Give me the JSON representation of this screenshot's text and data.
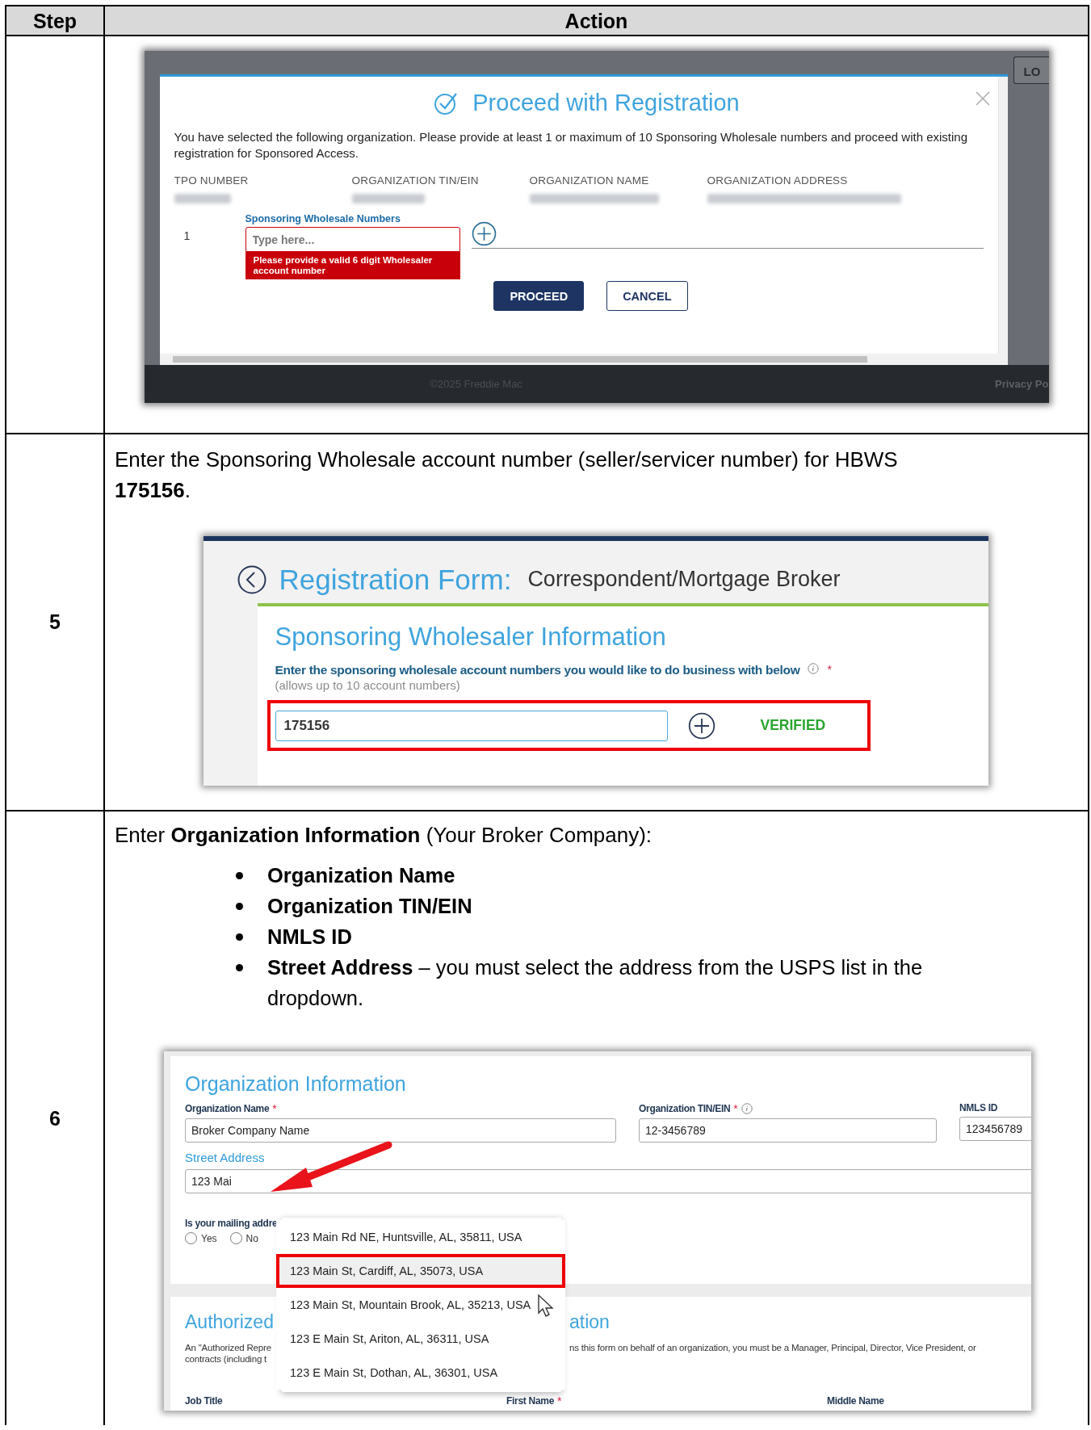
{
  "table": {
    "columns": [
      "Step",
      "Action"
    ],
    "rows": [
      {
        "kind": "modal_screenshot",
        "modal": {
          "title": "Proceed with Registration",
          "message": "You have selected the following organization. Please provide at least 1 or maximum of 10 Sponsoring Wholesale numbers and proceed with existing registration for Sponsored Access.",
          "columns": [
            "TPO NUMBER",
            "ORGANIZATION TIN/EIN",
            "ORGANIZATION NAME",
            "ORGANIZATION ADDRESS"
          ],
          "row_number": "1",
          "field_label": "Sponsoring Wholesale Numbers",
          "placeholder": "Type here...",
          "error": "Please provide a valid 6 digit Wholesaler account number",
          "buttons": [
            {
              "label": "PROCEED",
              "kind": "primary"
            },
            {
              "label": "CANCEL",
              "kind": "secondary"
            }
          ]
        },
        "background": {
          "button": "LO",
          "footer": "©2025 Freddie Mac",
          "footer_link": "Privacy Po"
        }
      },
      {
        "kind": "wholesaler_screenshot",
        "step": "5",
        "instruction": "Enter the Sponsoring Wholesale account number (seller/servicer number) for HBWS **175156**.",
        "screen": {
          "title": "Registration Form:",
          "subtitle": "Correspondent/Mortgage Broker",
          "section": "Sponsoring Wholesaler Information",
          "prompt": "Enter the sponsoring wholesale account numbers you would like to do business with below",
          "required_mark": "*",
          "hint": "(allows up to 10 account numbers)",
          "value": "175156",
          "status": "VERIFIED"
        }
      },
      {
        "kind": "organization_screenshot",
        "step": "6",
        "instruction": "Enter **Organization Information** (Your Broker Company):",
        "bullets": [
          {
            "text": "Organization Name",
            "bold": true
          },
          {
            "text": "Organization TIN/EIN",
            "bold": true
          },
          {
            "text": "NMLS ID",
            "bold": true
          },
          {
            "text": "**Street Address** – you must select the address from the USPS list in the dropdown.",
            "bold": false
          }
        ],
        "screen": {
          "section": "Organization Information",
          "fields": [
            {
              "label": "Organization Name",
              "required_mark": "*",
              "info": false,
              "value": "Broker Company Name"
            },
            {
              "label": "Organization TIN/EIN",
              "required_mark": "*",
              "info": true,
              "value": "12-3456789"
            },
            {
              "label": "NMLS ID",
              "info": false,
              "value": "123456789"
            }
          ],
          "street": {
            "label": "Street Address",
            "value": "123 Mai"
          },
          "mailing_question": "Is your mailing addre",
          "radios": [
            {
              "label": "Yes",
              "selected": false
            },
            {
              "label": "No",
              "selected": false
            }
          ],
          "suggestions": [
            {
              "text": "123 Main Rd NE, Huntsville, AL, 35811, USA",
              "selected": false
            },
            {
              "text": "123 Main St, Cardiff, AL, 35073, USA",
              "selected": true
            },
            {
              "text": "123 Main St, Mountain Brook, AL, 35213, USA",
              "selected": false
            },
            {
              "text": "123 E Main St, Ariton, AL, 36311, USA",
              "selected": false
            },
            {
              "text": "123 E Main St, Dothan, AL, 36301, USA",
              "selected": false
            }
          ],
          "auth_title_left": "Authorized",
          "auth_title_right": "ation",
          "auth_text_left": [
            "An \"Authorized Repre",
            "contracts (including t"
          ],
          "auth_text_right": "ns this form on behalf of an organization, you must be a Manager, Principal, Director, Vice President, or",
          "bottom_labels": [
            {
              "label": "Job Title"
            },
            {
              "label": "First Name",
              "required_mark": "*"
            },
            {
              "label": "Middle Name"
            }
          ]
        }
      }
    ]
  }
}
